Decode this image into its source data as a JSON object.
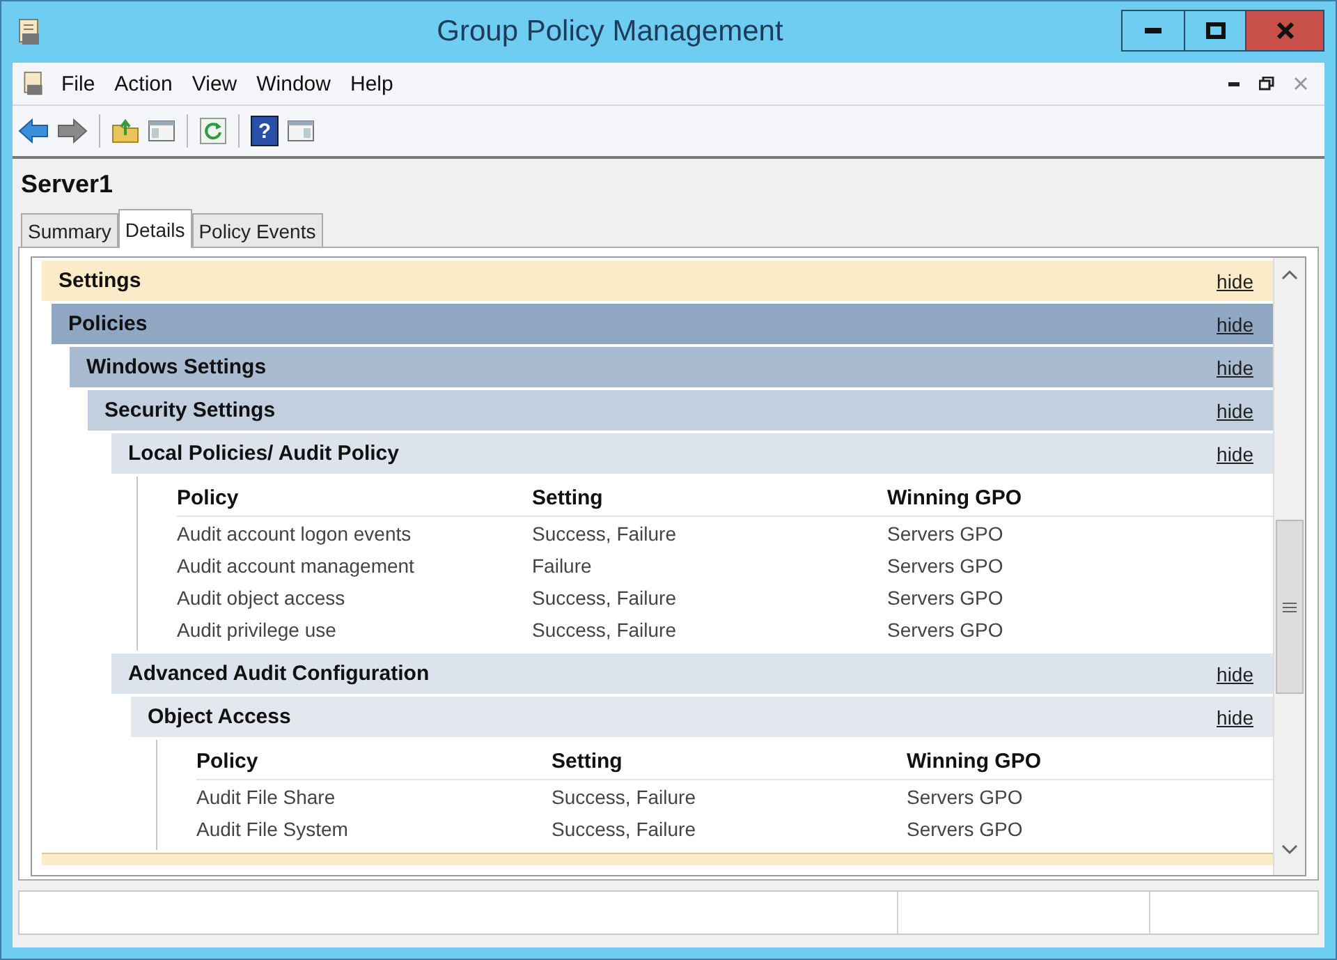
{
  "window": {
    "title": "Group Policy Management"
  },
  "menu": [
    {
      "label": "File"
    },
    {
      "label": "Action"
    },
    {
      "label": "View"
    },
    {
      "label": "Window"
    },
    {
      "label": "Help"
    }
  ],
  "toolbar": [
    {
      "kind": "back"
    },
    {
      "kind": "forward"
    },
    {
      "kind": "separator"
    },
    {
      "kind": "folder-up"
    },
    {
      "kind": "panel"
    },
    {
      "kind": "separator"
    },
    {
      "kind": "refresh"
    },
    {
      "kind": "separator"
    },
    {
      "kind": "help",
      "glyph": "?"
    },
    {
      "kind": "panel-right"
    }
  ],
  "heading": "Server1",
  "tabs": [
    {
      "label": "Summary",
      "selected": false
    },
    {
      "label": "Details",
      "selected": true
    },
    {
      "label": "Policy Events",
      "selected": false
    }
  ],
  "sections": [
    {
      "title": "Settings",
      "link": "hide",
      "children": [
        {
          "title": "Policies",
          "link": "hide",
          "children": [
            {
              "title": "Windows Settings",
              "link": "hide",
              "children": [
                {
                  "title": "Security Settings",
                  "link": "hide",
                  "children": [
                    {
                      "title": "Local Policies/ Audit Policy",
                      "link": "hide",
                      "table": {
                        "columns": [
                          "Policy",
                          "Setting",
                          "Winning GPO"
                        ],
                        "rows": [
                          [
                            "Audit account logon events",
                            "Success, Failure",
                            "Servers GPO"
                          ],
                          [
                            "Audit account management",
                            "Failure",
                            "Servers GPO"
                          ],
                          [
                            "Audit object access",
                            "Success, Failure",
                            "Servers GPO"
                          ],
                          [
                            "Audit privilege use",
                            "Success, Failure",
                            "Servers GPO"
                          ]
                        ]
                      }
                    },
                    {
                      "title": "Advanced Audit Configuration",
                      "link": "hide",
                      "children": [
                        {
                          "title": "Object Access",
                          "link": "hide",
                          "table": {
                            "columns": [
                              "Policy",
                              "Setting",
                              "Winning GPO"
                            ],
                            "rows": [
                              [
                                "Audit File Share",
                                "Success, Failure",
                                "Servers GPO"
                              ],
                              [
                                "Audit File System",
                                "Success, Failure",
                                "Servers GPO"
                              ]
                            ]
                          }
                        }
                      ]
                    }
                  ]
                }
              ]
            }
          ]
        }
      ]
    }
  ]
}
